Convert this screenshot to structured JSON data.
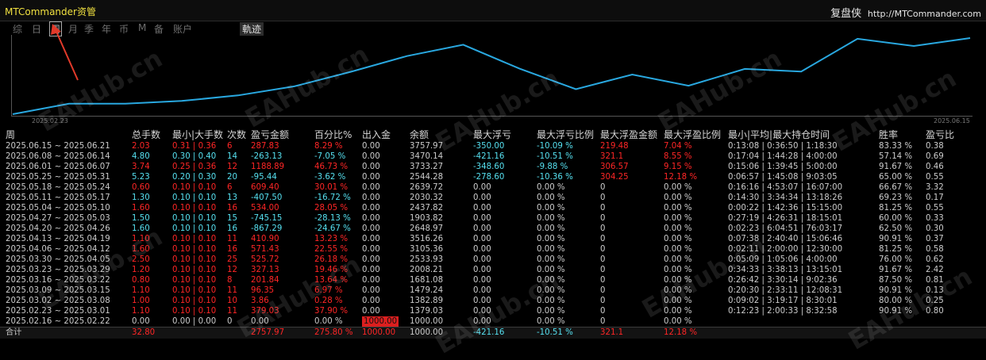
{
  "app_title": "MTCommander资管",
  "brand": {
    "name": "复盘侠",
    "url": "http://MTCommander.com"
  },
  "tabs": [
    "综",
    "日",
    "周",
    "月",
    "季",
    "年",
    "币",
    "M",
    "备",
    "账户"
  ],
  "active_tab": "周",
  "track_tab": "軌迹",
  "chart": {
    "start_date": "2025.02.23",
    "end_date": "2025.06.15",
    "line_color": "#29a8e0"
  },
  "headers": [
    "周",
    "总手数",
    "最小|大手数",
    "次数",
    "盈亏金额",
    "百分比%",
    "出入金",
    "余额",
    "最大浮亏",
    "最大浮亏比例",
    "最大浮盈金额",
    "最大浮盈比例",
    "最小|平均|最大持仓时间",
    "胜率",
    "盈亏比"
  ],
  "rows": [
    {
      "week": "2025.06.15 ~ 2025.06.21",
      "lots": "2.03",
      "minmax": "0.31 | 0.36",
      "count": "6",
      "pnl": "287.83",
      "pct": "8.29 %",
      "io": "0.00",
      "balance": "3757.97",
      "maxdd": "-350.00",
      "maxdd_pct": "-10.09 %",
      "maxfp": "219.48",
      "maxfp_pct": "7.04 %",
      "hold": "0:13:08 | 0:36:50 | 1:18:30",
      "win": "83.33 %",
      "pl": "0.38"
    },
    {
      "week": "2025.06.08 ~ 2025.06.14",
      "lots": "4.80",
      "minmax": "0.30 | 0.40",
      "count": "14",
      "pnl": "-263.13",
      "pct": "-7.05 %",
      "io": "0.00",
      "balance": "3470.14",
      "maxdd": "-421.16",
      "maxdd_pct": "-10.51 %",
      "maxfp": "321.1",
      "maxfp_pct": "8.55 %",
      "hold": "0:17:04 | 1:44:28 | 4:00:00",
      "win": "57.14 %",
      "pl": "0.69"
    },
    {
      "week": "2025.06.01 ~ 2025.06.07",
      "lots": "3.74",
      "minmax": "0.25 | 0.36",
      "count": "12",
      "pnl": "1188.89",
      "pct": "46.73 %",
      "io": "0.00",
      "balance": "3733.27",
      "maxdd": "-348.60",
      "maxdd_pct": "-9.88 %",
      "maxfp": "306.57",
      "maxfp_pct": "9.15 %",
      "hold": "0:15:06 | 1:39:45 | 5:00:00",
      "win": "91.67 %",
      "pl": "0.46"
    },
    {
      "week": "2025.05.25 ~ 2025.05.31",
      "lots": "5.23",
      "minmax": "0.20 | 0.30",
      "count": "20",
      "pnl": "-95.44",
      "pct": "-3.62 %",
      "io": "0.00",
      "balance": "2544.28",
      "maxdd": "-278.60",
      "maxdd_pct": "-10.36 %",
      "maxfp": "304.25",
      "maxfp_pct": "12.18 %",
      "hold": "0:06:57 | 1:45:08 | 9:03:05",
      "win": "65.00 %",
      "pl": "0.55"
    },
    {
      "week": "2025.05.18 ~ 2025.05.24",
      "lots": "0.60",
      "minmax": "0.10 | 0.10",
      "count": "6",
      "pnl": "609.40",
      "pct": "30.01 %",
      "io": "0.00",
      "balance": "2639.72",
      "maxdd": "0.00",
      "maxdd_pct": "0.00 %",
      "maxfp": "0",
      "maxfp_pct": "0.00 %",
      "hold": "0:16:16 | 4:53:07 | 16:07:00",
      "win": "66.67 %",
      "pl": "3.32"
    },
    {
      "week": "2025.05.11 ~ 2025.05.17",
      "lots": "1.30",
      "minmax": "0.10 | 0.10",
      "count": "13",
      "pnl": "-407.50",
      "pct": "-16.72 %",
      "io": "0.00",
      "balance": "2030.32",
      "maxdd": "0.00",
      "maxdd_pct": "0.00 %",
      "maxfp": "0",
      "maxfp_pct": "0.00 %",
      "hold": "0:14:30 | 3:34:34 | 13:18:26",
      "win": "69.23 %",
      "pl": "0.17"
    },
    {
      "week": "2025.05.04 ~ 2025.05.10",
      "lots": "1.60",
      "minmax": "0.10 | 0.10",
      "count": "16",
      "pnl": "534.00",
      "pct": "28.05 %",
      "io": "0.00",
      "balance": "2437.82",
      "maxdd": "0.00",
      "maxdd_pct": "0.00 %",
      "maxfp": "0",
      "maxfp_pct": "0.00 %",
      "hold": "0:00:22 | 1:42:36 | 15:15:00",
      "win": "81.25 %",
      "pl": "0.55"
    },
    {
      "week": "2025.04.27 ~ 2025.05.03",
      "lots": "1.50",
      "minmax": "0.10 | 0.10",
      "count": "15",
      "pnl": "-745.15",
      "pct": "-28.13 %",
      "io": "0.00",
      "balance": "1903.82",
      "maxdd": "0.00",
      "maxdd_pct": "0.00 %",
      "maxfp": "0",
      "maxfp_pct": "0.00 %",
      "hold": "0:27:19 | 4:26:31 | 18:15:01",
      "win": "60.00 %",
      "pl": "0.33"
    },
    {
      "week": "2025.04.20 ~ 2025.04.26",
      "lots": "1.60",
      "minmax": "0.10 | 0.10",
      "count": "16",
      "pnl": "-867.29",
      "pct": "-24.67 %",
      "io": "0.00",
      "balance": "2648.97",
      "maxdd": "0.00",
      "maxdd_pct": "0.00 %",
      "maxfp": "0",
      "maxfp_pct": "0.00 %",
      "hold": "0:02:23 | 6:04:51 | 76:03:17",
      "win": "62.50 %",
      "pl": "0.30"
    },
    {
      "week": "2025.04.13 ~ 2025.04.19",
      "lots": "1.10",
      "minmax": "0.10 | 0.10",
      "count": "11",
      "pnl": "410.90",
      "pct": "13.23 %",
      "io": "0.00",
      "balance": "3516.26",
      "maxdd": "0.00",
      "maxdd_pct": "0.00 %",
      "maxfp": "0",
      "maxfp_pct": "0.00 %",
      "hold": "0:07:38 | 2:40:40 | 15:06:46",
      "win": "90.91 %",
      "pl": "0.37"
    },
    {
      "week": "2025.04.06 ~ 2025.04.12",
      "lots": "1.60",
      "minmax": "0.10 | 0.10",
      "count": "16",
      "pnl": "571.43",
      "pct": "22.55 %",
      "io": "0.00",
      "balance": "3105.36",
      "maxdd": "0.00",
      "maxdd_pct": "0.00 %",
      "maxfp": "0",
      "maxfp_pct": "0.00 %",
      "hold": "0:02:11 | 2:00:00 | 12:30:00",
      "win": "81.25 %",
      "pl": "0.58"
    },
    {
      "week": "2025.03.30 ~ 2025.04.05",
      "lots": "2.50",
      "minmax": "0.10 | 0.10",
      "count": "25",
      "pnl": "525.72",
      "pct": "26.18 %",
      "io": "0.00",
      "balance": "2533.93",
      "maxdd": "0.00",
      "maxdd_pct": "0.00 %",
      "maxfp": "0",
      "maxfp_pct": "0.00 %",
      "hold": "0:05:09 | 1:05:06 | 4:00:00",
      "win": "76.00 %",
      "pl": "0.62"
    },
    {
      "week": "2025.03.23 ~ 2025.03.29",
      "lots": "1.20",
      "minmax": "0.10 | 0.10",
      "count": "12",
      "pnl": "327.13",
      "pct": "19.46 %",
      "io": "0.00",
      "balance": "2008.21",
      "maxdd": "0.00",
      "maxdd_pct": "0.00 %",
      "maxfp": "0",
      "maxfp_pct": "0.00 %",
      "hold": "0:34:33 | 3:38:13 | 13:15:01",
      "win": "91.67 %",
      "pl": "2.42"
    },
    {
      "week": "2025.03.16 ~ 2025.03.22",
      "lots": "0.80",
      "minmax": "0.10 | 0.10",
      "count": "8",
      "pnl": "201.84",
      "pct": "13.64 %",
      "io": "0.00",
      "balance": "1681.08",
      "maxdd": "0.00",
      "maxdd_pct": "0.00 %",
      "maxfp": "0",
      "maxfp_pct": "0.00 %",
      "hold": "0:26:42 | 3:30:14 | 9:02:36",
      "win": "87.50 %",
      "pl": "0.81"
    },
    {
      "week": "2025.03.09 ~ 2025.03.15",
      "lots": "1.10",
      "minmax": "0.10 | 0.10",
      "count": "11",
      "pnl": "96.35",
      "pct": "6.97 %",
      "io": "0.00",
      "balance": "1479.24",
      "maxdd": "0.00",
      "maxdd_pct": "0.00 %",
      "maxfp": "0",
      "maxfp_pct": "0.00 %",
      "hold": "0:20:30 | 2:33:11 | 12:08:31",
      "win": "90.91 %",
      "pl": "0.13"
    },
    {
      "week": "2025.03.02 ~ 2025.03.08",
      "lots": "1.00",
      "minmax": "0.10 | 0.10",
      "count": "10",
      "pnl": "3.86",
      "pct": "0.28 %",
      "io": "0.00",
      "balance": "1382.89",
      "maxdd": "0.00",
      "maxdd_pct": "0.00 %",
      "maxfp": "0",
      "maxfp_pct": "0.00 %",
      "hold": "0:09:02 | 3:19:17 | 8:30:01",
      "win": "80.00 %",
      "pl": "0.25"
    },
    {
      "week": "2025.02.23 ~ 2025.03.01",
      "lots": "1.10",
      "minmax": "0.10 | 0.10",
      "count": "11",
      "pnl": "379.03",
      "pct": "37.90 %",
      "io": "0.00",
      "balance": "1379.03",
      "maxdd": "0.00",
      "maxdd_pct": "0.00 %",
      "maxfp": "0",
      "maxfp_pct": "0.00 %",
      "hold": "0:12:23 | 2:00:33 | 8:32:58",
      "win": "90.91 %",
      "pl": "0.80"
    },
    {
      "week": "2025.02.16 ~ 2025.02.22",
      "lots": "0.00",
      "minmax": "0.00 | 0.00",
      "count": "0",
      "pnl": "0.00",
      "pct": "0.00 %",
      "io": "1000.00",
      "balance": "1000.00",
      "maxdd": "0.00",
      "maxdd_pct": "0.00 %",
      "maxfp": "0",
      "maxfp_pct": "0.00 %",
      "hold": "",
      "win": "",
      "pl": ""
    }
  ],
  "total": {
    "label": "合计",
    "lots": "32.80",
    "pnl": "2757.97",
    "pct": "275.80 %",
    "io": "1000.00",
    "balance": "1000.00",
    "maxdd": "-421.16",
    "maxdd_pct": "-10.51 %",
    "maxfp": "321.1",
    "maxfp_pct": "12.18 %"
  },
  "watermark": "EAHub.cn",
  "colors": {
    "positive": "#ff2626",
    "negative": "#56e0f0",
    "neutral": "#cccccc",
    "accent": "#f0e040",
    "arrow": "#e23a2a"
  }
}
